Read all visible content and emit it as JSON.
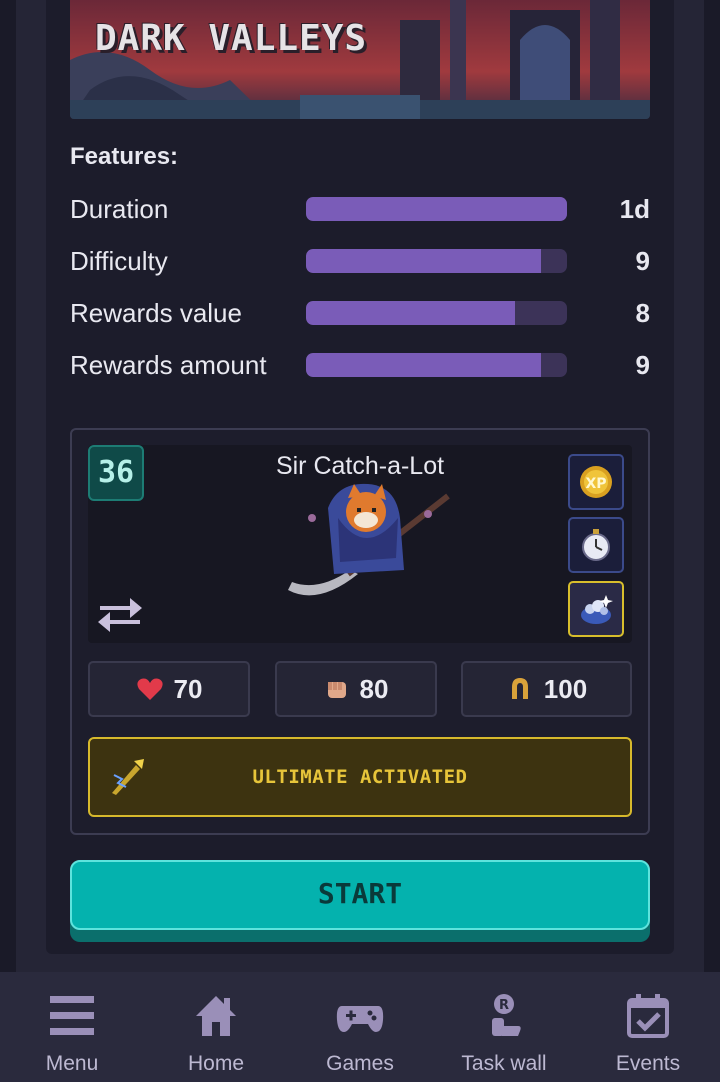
{
  "banner": {
    "title": "DARK VALLEYS"
  },
  "features": {
    "title": "Features:",
    "items": [
      {
        "label": "Duration",
        "value": "1d",
        "level": 1.0
      },
      {
        "label": "Difficulty",
        "value": "9",
        "level": 0.9
      },
      {
        "label": "Rewards value",
        "value": "8",
        "level": 0.8
      },
      {
        "label": "Rewards amount",
        "value": "9",
        "level": 0.9
      }
    ]
  },
  "hero": {
    "level": "36",
    "name": "Sir Catch-a-Lot",
    "perks": [
      "xp-boost-icon",
      "stopwatch-icon",
      "treasure-icon"
    ],
    "stats": [
      {
        "icon": "heart-icon",
        "value": "70"
      },
      {
        "icon": "fist-icon",
        "value": "80"
      },
      {
        "icon": "horseshoe-icon",
        "value": "100"
      }
    ]
  },
  "ultimate": {
    "label": "ULTIMATE ACTIVATED"
  },
  "start": {
    "label": "START"
  },
  "nav": {
    "items": [
      {
        "label": "Menu"
      },
      {
        "label": "Home"
      },
      {
        "label": "Games"
      },
      {
        "label": "Task wall"
      },
      {
        "label": "Events"
      }
    ]
  },
  "colors": {
    "accent_purple": "#7a5cb8",
    "start_teal": "#04b2ae",
    "ultimate_gold": "#d7b92c"
  }
}
